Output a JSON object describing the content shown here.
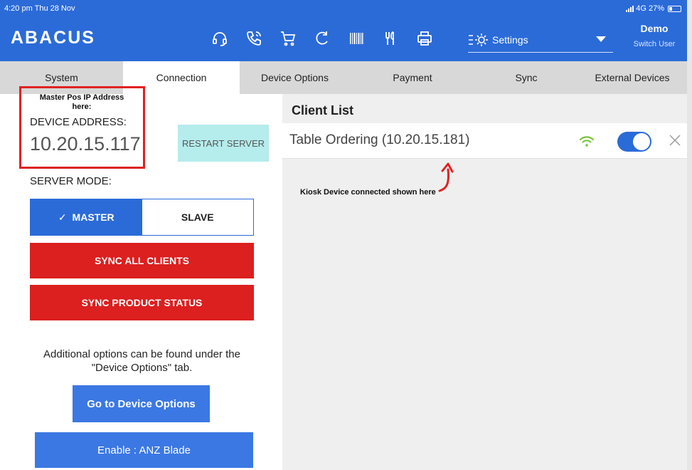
{
  "status_bar": {
    "time": "4:20 pm",
    "date": "Thu 28 Nov",
    "network": "4G",
    "battery": "27%",
    "battery_level": 0.27
  },
  "app": {
    "brand": "ABACUS"
  },
  "toolbar": {
    "icons": [
      "headset-icon",
      "phone-icon",
      "cart-icon",
      "refresh-icon",
      "barcode-icon",
      "utensils-icon",
      "printer-icon"
    ],
    "settings_label": "Settings"
  },
  "user": {
    "name": "Demo",
    "switch_label": "Switch User"
  },
  "tabs": [
    {
      "label": "System",
      "active": false
    },
    {
      "label": "Connection",
      "active": true
    },
    {
      "label": "Device Options",
      "active": false
    },
    {
      "label": "Payment",
      "active": false
    },
    {
      "label": "Sync",
      "active": false
    },
    {
      "label": "External Devices",
      "active": false
    }
  ],
  "connection": {
    "annotation": "Master Pos IP Address here:",
    "device_address_label": "DEVICE ADDRESS:",
    "device_address": "10.20.15.117",
    "restart_label": "RESTART SERVER",
    "server_mode_label": "SERVER MODE:",
    "mode_master": "MASTER",
    "mode_slave": "SLAVE",
    "mode_selected": "MASTER",
    "sync_all_label": "SYNC ALL CLIENTS",
    "sync_product_label": "SYNC PRODUCT STATUS",
    "help_text": "Additional options can be found under the \"Device Options\" tab.",
    "goto_label": "Go to Device Options",
    "enable_label": "Enable : ANZ Blade"
  },
  "client_list": {
    "title": "Client List",
    "clients": [
      {
        "name": "Table Ordering (10.20.15.181)",
        "enabled": true
      }
    ],
    "annotation": "Kiosk Device connected shown here"
  },
  "colors": {
    "primary": "#2b6bd8",
    "danger": "#dc1f1f",
    "restart": "#b5ecec",
    "annotation": "#e02222",
    "wifi": "#7cc23a"
  }
}
